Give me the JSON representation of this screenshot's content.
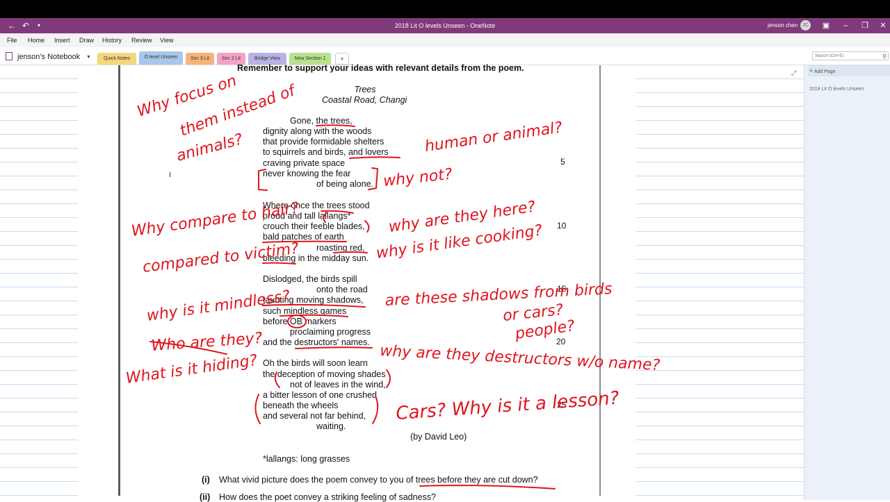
{
  "window": {
    "title": "2018 Lit O levels Unseen  -  OneNote",
    "user_name": "jenson chen",
    "user_initials": "JC"
  },
  "menu": [
    "File",
    "Home",
    "Insert",
    "Draw",
    "History",
    "Review",
    "View"
  ],
  "notebook": {
    "name": "jenson's Notebook"
  },
  "sections": [
    {
      "label": "Quick Notes",
      "color": "#f6d67c"
    },
    {
      "label": "O level Unseen",
      "color": "#a6c8ea"
    },
    {
      "label": "Sec 3 Lit",
      "color": "#f5b47a"
    },
    {
      "label": "Sec 2 Lit",
      "color": "#f2a3c7"
    },
    {
      "label": "Bridge View",
      "color": "#b7b3e6"
    },
    {
      "label": "New Section 1",
      "color": "#b9e08e"
    },
    {
      "label": "+",
      "color": "#ffffff"
    }
  ],
  "search": {
    "placeholder": "Search (Ctrl+E)"
  },
  "pages_panel": {
    "add_page": "Add Page",
    "pages": [
      "2018 Lit O levels Unseen"
    ]
  },
  "document": {
    "instruction": "Remember to support your ideas with relevant details from the poem.",
    "poem_title": "Trees",
    "poem_subtitle": "Coastal Road, Changi",
    "lines": [
      "Gone, the trees,",
      "dignity along with the woods",
      "that provide formidable shelters",
      "to squirrels and birds, and lovers",
      "craving private space",
      "never knowing the fear",
      "of being alone.",
      "Where once the trees stood",
      "proud and tall lallangs*",
      "crouch their feeble blades,",
      "bald patches of earth",
      "roasting red,",
      "bleeding in the midday sun.",
      "Dislodged, the birds spill",
      "onto the road",
      "taunting moving shadows,",
      "such mindless games",
      "before OB markers",
      "proclaiming progress",
      "and the destructors' names.",
      "Oh the birds will soon learn",
      "the deception of moving shades",
      "not of leaves in the wind,",
      "a bitter lesson of one crushed",
      "beneath the wheels",
      "and several not far behind,",
      "waiting."
    ],
    "line_numbers": [
      "5",
      "10",
      "15",
      "20",
      "25"
    ],
    "author": "(by David Leo)",
    "footnote": "*lallangs: long grasses",
    "question_i_num": "(i)",
    "question_i": "What vivid picture does the poem convey to you of trees before they are cut down?",
    "question_ii_num": "(ii)",
    "question_ii": "How does the poet convey a striking feeling of sadness?"
  },
  "annotations": {
    "a1": "Why focus on",
    "a2": "them instead of",
    "a3": "animals?",
    "a4": "human or animal?",
    "a5": "why not?",
    "a6": "Why compare to hair?",
    "a7": "why are they here?",
    "a8": "compared to victim?",
    "a9": "why is it like cooking?",
    "a10": "why is it mindless?",
    "a11": "are these shadows from birds",
    "a12": "or cars?",
    "a13": "people?",
    "a14": "Who are they?",
    "a15": "why are they destructors w/o name?",
    "a16": "What is it hiding?",
    "a17": "Cars? Why is it a lesson?"
  },
  "ink_color": "#e0141e"
}
